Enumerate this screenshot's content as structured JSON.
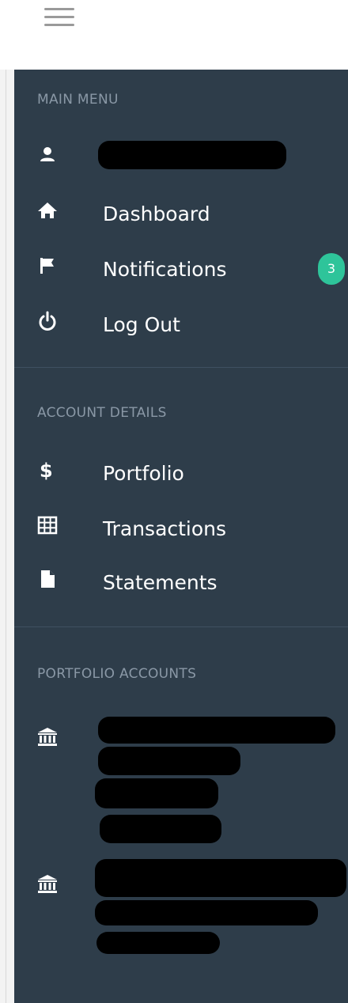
{
  "main_menu": {
    "title": "MAIN MENU",
    "items": [
      {
        "icon": "home-icon",
        "label": "Dashboard"
      },
      {
        "icon": "flag-icon",
        "label": "Notifications",
        "badge": "3"
      },
      {
        "icon": "power-icon",
        "label": "Log Out"
      }
    ]
  },
  "account_details": {
    "title": "ACCOUNT DETAILS",
    "items": [
      {
        "icon": "dollar-icon",
        "label": "Portfolio"
      },
      {
        "icon": "table-grid-icon",
        "label": "Transactions"
      },
      {
        "icon": "document-icon",
        "label": "Statements"
      }
    ]
  },
  "portfolio_accounts": {
    "title": "PORTFOLIO ACCOUNTS",
    "items": [
      {
        "icon": "bank-icon"
      },
      {
        "icon": "bank-icon"
      }
    ]
  },
  "colors": {
    "sidebar_bg": "#2e3d4a",
    "section_title": "#8a98a6",
    "badge_bg": "#2ec49a"
  }
}
